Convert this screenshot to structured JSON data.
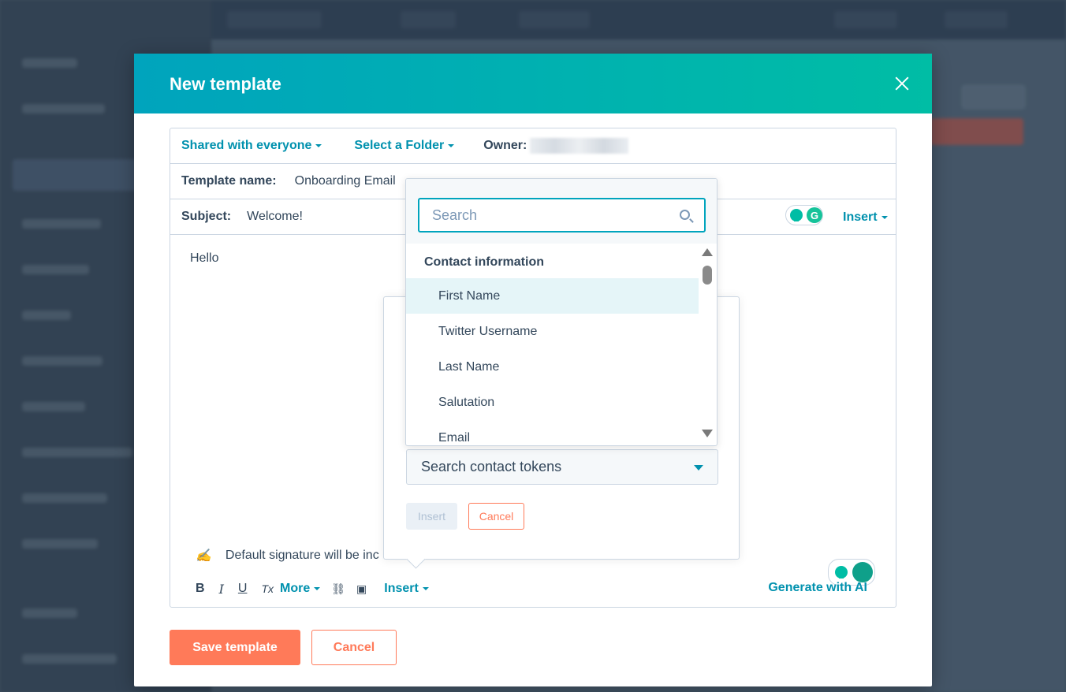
{
  "modal": {
    "title": "New template",
    "sharing_label": "Shared with everyone",
    "folder_label": "Select a Folder",
    "owner_label": "Owner:",
    "template_name_label": "Template name:",
    "template_name_value": "Onboarding Email",
    "subject_label": "Subject:",
    "subject_value": "Welcome!",
    "insert_label": "Insert",
    "body_text": "Hello",
    "signature_text": "Default signature will be inc",
    "toolbar": {
      "bold": "B",
      "italic": "I",
      "underline": "U",
      "clear_format": "Tx",
      "more": "More",
      "insert": "Insert",
      "generate_ai": "Generate with AI"
    },
    "save_button": "Save template",
    "cancel_button": "Cancel"
  },
  "token_popover": {
    "select_value": "Search contact tokens",
    "insert_button": "Insert",
    "cancel_button": "Cancel"
  },
  "dropdown": {
    "search_placeholder": "Search",
    "group_label": "Contact information",
    "items": [
      {
        "label": "First Name"
      },
      {
        "label": "Twitter Username"
      },
      {
        "label": "Last Name"
      },
      {
        "label": "Salutation"
      },
      {
        "label": "Email"
      }
    ]
  },
  "colors": {
    "header_gradient_start": "#00a4bd",
    "header_gradient_end": "#00bda5",
    "link": "#0091ae",
    "primary": "#ff7a59",
    "text": "#33475b"
  },
  "icons": {
    "close": "close-icon",
    "search": "search-icon",
    "signature": "signature-icon",
    "link": "link-icon",
    "image": "image-icon",
    "bulb": "lightbulb-icon",
    "grammarly": "grammarly-icon"
  }
}
